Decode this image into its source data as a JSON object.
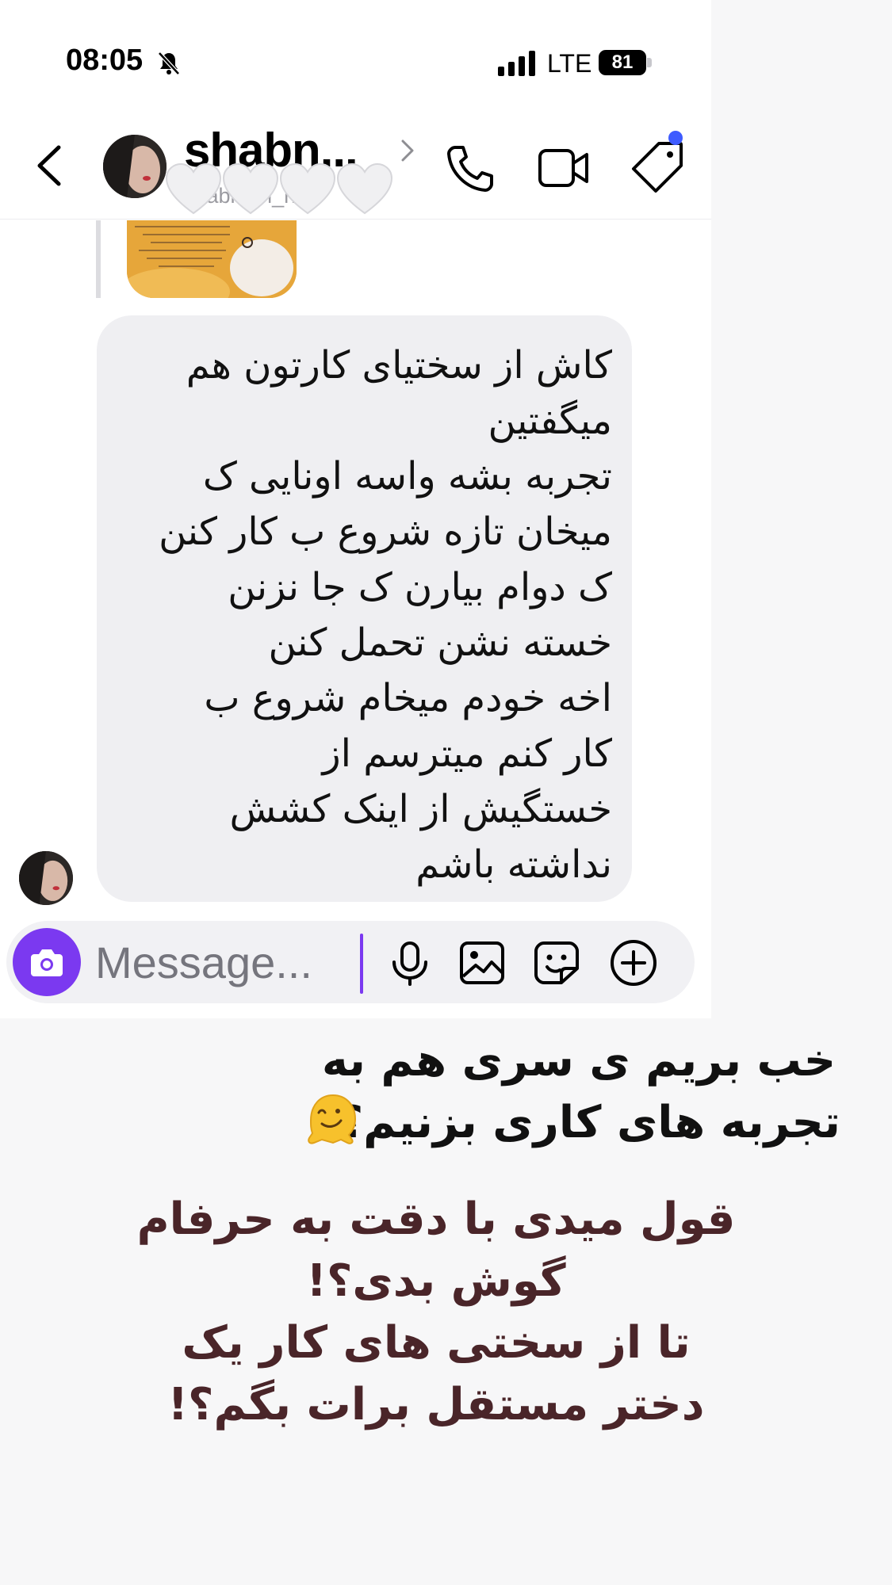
{
  "status_bar": {
    "time": "08:05",
    "network": "LTE",
    "battery": "81",
    "icons": [
      "bell-slash-icon",
      "signal-bars-icon",
      "battery-icon"
    ]
  },
  "header": {
    "contact_name": "shabn...",
    "contact_username": "shabnam_nu",
    "icons": [
      "back-icon",
      "chevron-right-icon",
      "call-icon",
      "video-icon",
      "tag-icon"
    ],
    "notification_dot_color": "#3e5bff",
    "hearts_sticker_count": 4
  },
  "message": {
    "text": "کاش از سختیای کارتون هم\nمیگفتین\nتجربه بشه واسه اونایی ک\nمیخان تازه شروع ب کار کنن\nک دوام  بیارن ک جا نزنن\nخسته نشن تحمل کنن\nاخه خودم میخام شروع ب\nکار کنم میترسم از\nخستگیش از اینک کشش\nنداشته باشم"
  },
  "composer": {
    "placeholder": "Message...",
    "accent_color": "#7b39f0",
    "icons": [
      "camera-icon",
      "mic-icon",
      "gallery-icon",
      "sticker-icon",
      "add-icon"
    ]
  },
  "story_overlay": {
    "line1": "خب بریم ی سری هم به\nتجربه های کاری بزنیم؟!",
    "emoji": "melting-face-emoji",
    "line2": "قول میدی با دقت به حرفام\nگوش بدی؟!\nتا از سختی های کار یک\nدختر مستقل برات بگم؟!",
    "line2_color": "#4a2529"
  }
}
